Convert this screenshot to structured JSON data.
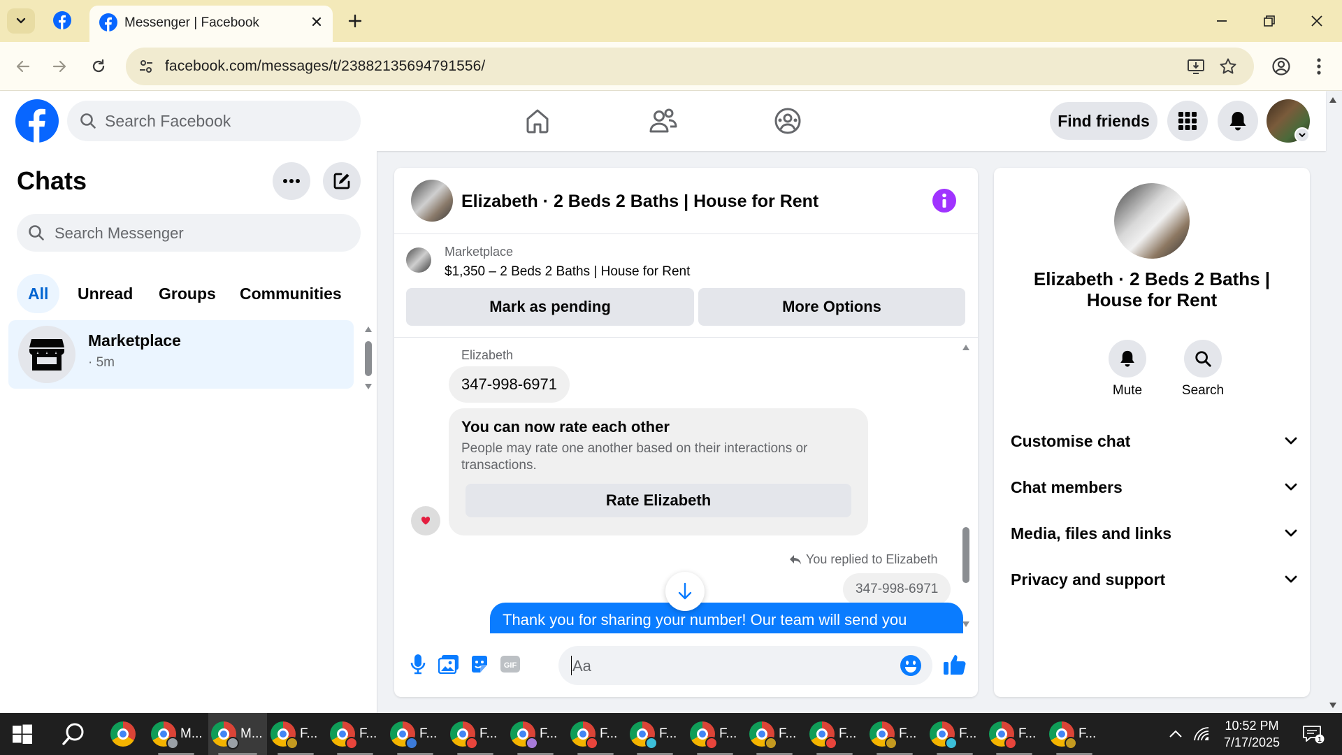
{
  "browser": {
    "tab_title": "Messenger | Facebook",
    "url": "facebook.com/messages/t/23882135694791556/"
  },
  "fb_header": {
    "search_placeholder": "Search Facebook",
    "find_friends": "Find friends"
  },
  "chats": {
    "title": "Chats",
    "search_placeholder": "Search Messenger",
    "filters": [
      "All",
      "Unread",
      "Groups",
      "Communities"
    ],
    "active_filter": "All",
    "items": [
      {
        "name": "Marketplace",
        "time": "· 5m"
      }
    ]
  },
  "conversation": {
    "title": "Elizabeth · 2 Beds 2 Baths | House for Rent",
    "marketplace_label": "Marketplace",
    "listing": "$1,350 – 2 Beds 2 Baths | House for Rent",
    "mark_pending": "Mark as pending",
    "more_options": "More Options",
    "sender_name": "Elizabeth",
    "incoming_message": "347-998-6971",
    "rate_card": {
      "title": "You can now rate each other",
      "body": "People may rate one another based on their interactions or transactions.",
      "button": "Rate Elizabeth"
    },
    "replied_label": "You replied to Elizabeth",
    "quoted_message": "347-998-6971",
    "outgoing_message": "Thank you for sharing your number!  Our team will send you",
    "composer_placeholder": "Aa",
    "gif_label": "GIF"
  },
  "info_panel": {
    "name": "Elizabeth · 2 Beds 2 Baths | House for Rent",
    "actions": [
      "Mute",
      "Search"
    ],
    "sections": [
      "Customise chat",
      "Chat members",
      "Media, files and links",
      "Privacy and support"
    ]
  },
  "taskbar": {
    "items": [
      "M...",
      "M...",
      "F...",
      "F...",
      "F...",
      "F...",
      "F...",
      "F...",
      "F...",
      "F...",
      "F...",
      "F...",
      "F...",
      "F...",
      "F...",
      "F..."
    ],
    "time": "10:52 PM",
    "date": "7/17/2025",
    "notification_count": "1"
  },
  "colors": {
    "fb_blue": "#0866ff",
    "messenger_blue": "#0a7cff",
    "info_purple": "#a033ff",
    "tabstrip": "#f3e9b9"
  }
}
